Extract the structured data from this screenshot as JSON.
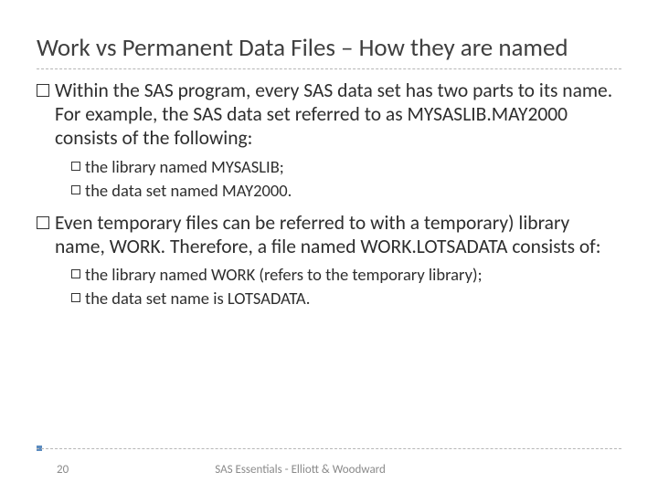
{
  "title": "Work vs Permanent Data Files – How they are named",
  "bullets": [
    {
      "text": "Within the SAS program, every SAS data set has two parts to its name. For example, the SAS data set referred to as MYSASLIB.MAY2000 consists of the following:",
      "sub": [
        "the library named MYSASLIB;",
        "the data set named MAY2000."
      ]
    },
    {
      "text": "Even temporary files can be referred to with a temporary) library name, WORK. Therefore, a file named WORK.LOTSADATA consists of:",
      "sub": [
        "the library named WORK (refers to the temporary library);",
        "the data set name is LOTSADATA."
      ]
    }
  ],
  "footer": {
    "page": "20",
    "center": "SAS Essentials - Elliott & Woodward"
  }
}
